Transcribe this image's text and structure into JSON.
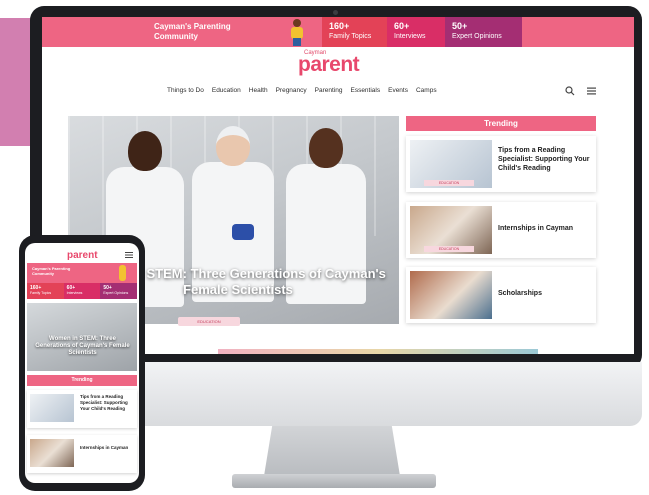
{
  "colors": {
    "brand_pink": "#ee6583",
    "stat_red": "#e34257",
    "stat_magenta": "#d92e66",
    "stat_purple": "#a42e73",
    "decor_pink": "#d27fb0"
  },
  "topband": {
    "community": "Cayman's Parenting Community",
    "stats": [
      {
        "num": "160+",
        "label": "Family Topics"
      },
      {
        "num": "60+",
        "label": "Interviews"
      },
      {
        "num": "50+",
        "label": "Expert Opinions"
      }
    ]
  },
  "header": {
    "logo_small": "Cayman",
    "logo": "parent",
    "nav": [
      "Things to Do",
      "Education",
      "Health",
      "Pregnancy",
      "Parenting",
      "Essentials",
      "Events",
      "Camps"
    ],
    "icons": [
      "search-icon",
      "menu-icon"
    ]
  },
  "hero": {
    "title": "...men in STEM: Three Generations of Cayman's Female Scientists",
    "badge": "EDUCATION"
  },
  "trending": {
    "heading": "Trending",
    "items": [
      {
        "title": "Tips from a Reading Specialist: Supporting Your Child's Reading",
        "badge": "EDUCATION"
      },
      {
        "title": "Internships in Cayman",
        "badge": "EDUCATION"
      },
      {
        "title": "Scholarships",
        "badge": ""
      }
    ]
  },
  "phone": {
    "logo": "parent",
    "community": "Cayman's Parenting Community",
    "stats": [
      {
        "num": "160+",
        "label": "Family Topics"
      },
      {
        "num": "60+",
        "label": "Interviews"
      },
      {
        "num": "50+",
        "label": "Expert Opinions"
      }
    ],
    "hero_title": "Women in STEM: Three Generations of Cayman's Female Scientists",
    "trending_heading": "Trending",
    "items": [
      {
        "title": "Tips from a Reading Specialist: Supporting Your Child's Reading"
      },
      {
        "title": "Internships in Cayman"
      }
    ]
  }
}
